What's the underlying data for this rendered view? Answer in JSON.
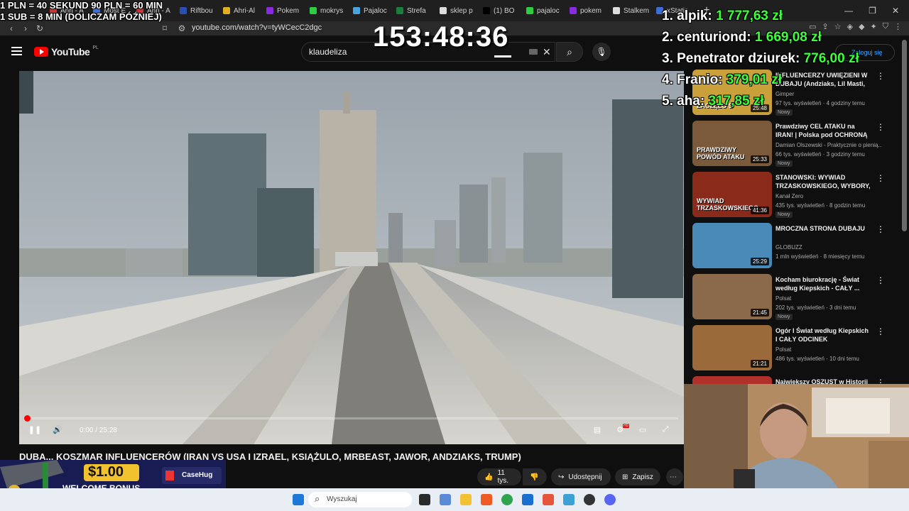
{
  "browser": {
    "tabs": [
      "Ahri - A",
      "Most E",
      "Ahri - A",
      "Riftbou",
      "Ahri-Al",
      "Pokem",
      "mokrys",
      "Pajaloc",
      "Strefa",
      "sklep p",
      "(1) BO",
      "pajaloc",
      "pokem",
      "Stalkem",
      "xStatic"
    ],
    "url": "youtube.com/watch?v=tyWCecC2dgc"
  },
  "youtube": {
    "logo_text": "YouTube",
    "logo_country": "PL",
    "search_value": "klaudeliza",
    "login_label": "Zaloguj się"
  },
  "player": {
    "time": "0:00 / 25:28",
    "progress_fraction": 0.0
  },
  "video": {
    "title": "DUBA... KOSZMAR INFLUENCERÓW (IRAN VS USA I IZRAEL, KSIĄŻULO, MRBEAST, JAWOR, ANDZIAKS, TRUMP)",
    "likes": "11 tys.",
    "share_label": "Udostępnij",
    "save_label": "Zapisz"
  },
  "recommendations": [
    {
      "title": "INFLUENCERZY UWIĘZIENI W DUBAJU (Andziaks, Lil Masti, ...",
      "channel": "Gimper",
      "meta": "97 tys. wyświetleń · 4 godziny temu",
      "badge": "Nowy",
      "duration": "25:48",
      "thumb_text": "ZACZĘŁO S",
      "color": "#c9a03a"
    },
    {
      "title": "Prawdziwy CEL ATAKU na IRAN! | Polska pod OCHRONĄ Francji...",
      "channel": "Damian Olszewski - Praktycznie o pienią...",
      "meta": "66 tys. wyświetleń · 3 godziny temu",
      "badge": "Nowy",
      "duration": "25:33",
      "thumb_text": "PRAWDZIWY POWÓD ATAKU",
      "color": "#7a5a3a"
    },
    {
      "title": "STANOWSKI: WYWIAD TRZASKOWSKIEGO, WYBORY, ...",
      "channel": "Kanał Zero",
      "meta": "435 tys. wyświetleń · 8 godzin temu",
      "badge": "Nowy",
      "duration": "41:36",
      "thumb_text": "WYWIAD TRZASKOWSKIEGO",
      "color": "#8a2a1a"
    },
    {
      "title": "MROCZNA STRONA DUBAJU",
      "channel": "GLOBUZZ",
      "meta": "1 mln wyświetleń · 8 miesięcy temu",
      "badge": "",
      "duration": "25:29",
      "thumb_text": "",
      "color": "#4a8ab8"
    },
    {
      "title": "Kocham biurokrację - Świat według Kiepskich - CAŁY ...",
      "channel": "Polsat",
      "meta": "202 tys. wyświetleń · 3 dni temu",
      "badge": "Nowy",
      "duration": "21:45",
      "thumb_text": "",
      "color": "#8a6a4a"
    },
    {
      "title": "Ogór I Świat według Kiepskich I CAŁY ODCINEK",
      "channel": "Polsat",
      "meta": "486 tys. wyświetleń · 10 dni temu",
      "badge": "",
      "duration": "21:21",
      "thumb_text": "",
      "color": "#9a6a3a"
    },
    {
      "title": "Największy OSZUST w Historii ...",
      "channel": "",
      "meta": "",
      "badge": "",
      "duration": "",
      "thumb_text": "",
      "color": "#b0302a"
    }
  ],
  "overlay": {
    "rule1": "1 PLN = 40 SEKUND 90 PLN = 60 MIN",
    "rule2": "1 SUB = 8 MIN (DOLICZAM PÓŹNIEJ)",
    "timer": "153:48:36",
    "leaderboard": [
      {
        "name": "1. alpik:",
        "amount": "1 777,63 zł"
      },
      {
        "name": "2. centuriond:",
        "amount": "1 669,08 zł"
      },
      {
        "name": "3. Penetrator dziurek:",
        "amount": "776,00 zł"
      },
      {
        "name": "4. Franio:",
        "amount": "379,01 zł"
      },
      {
        "name": "5. aha:",
        "amount": "317,85 zł"
      }
    ]
  },
  "promo": {
    "amount": "$1.00",
    "label": "WELCOME BONUS",
    "brand": "CaseHug"
  },
  "taskbar": {
    "search_placeholder": "Wyszukaj"
  }
}
